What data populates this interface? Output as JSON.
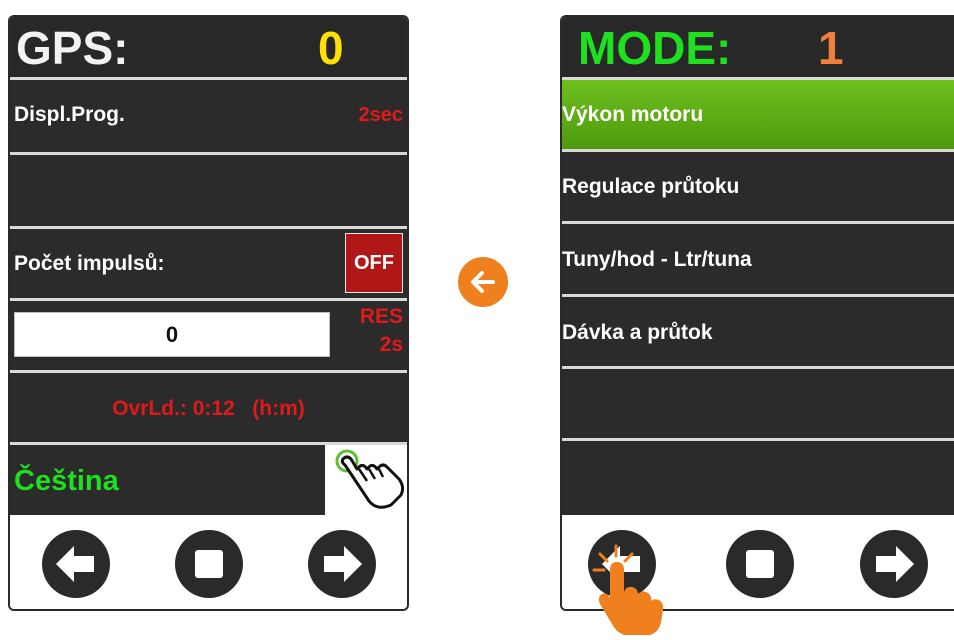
{
  "left_screen": {
    "header": {
      "label": "GPS:",
      "value": "0"
    },
    "rows": {
      "displ_label": "Displ.Prog.",
      "displ_value": "2sec",
      "impulse_label": "Počet impulsů:",
      "impulse_toggle": "OFF",
      "counter_value": "0",
      "res_label": "RES",
      "res_time": "2s",
      "overload_text": "OvrLd.: 0:12   (h:m)",
      "language": "Čeština"
    },
    "footer": {
      "prev": "arrow-left-icon",
      "stop": "stop-icon",
      "next": "arrow-right-icon"
    }
  },
  "right_screen": {
    "header": {
      "label": "MODE:",
      "value": "1"
    },
    "menu": [
      {
        "label": "Výkon motoru",
        "selected": true
      },
      {
        "label": "Regulace průtoku",
        "selected": false
      },
      {
        "label": "Tuny/hod - Ltr/tuna",
        "selected": false
      },
      {
        "label": "Dávka a průtok",
        "selected": false
      },
      {
        "label": "",
        "selected": false
      },
      {
        "label": "",
        "selected": false
      }
    ]
  },
  "colors": {
    "accent_orange": "#f07f1e",
    "selected_green": "#5fae16",
    "warning_red": "#e01a1a",
    "gps_yellow": "#ffe000",
    "mode_green": "#1ee01e",
    "mode_orange": "#f07f3a"
  }
}
